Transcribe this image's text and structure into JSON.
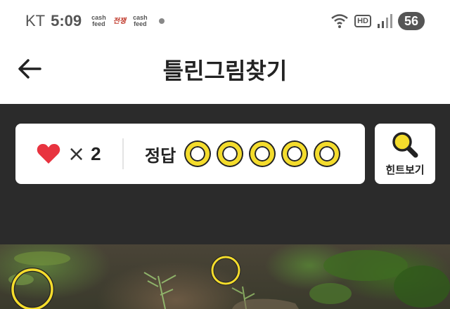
{
  "status_bar": {
    "carrier": "KT",
    "time": "5:09",
    "notifications": [
      {
        "line1": "cash",
        "line2": "feed",
        "color": "#555555"
      },
      {
        "line1": "전쟁",
        "line2": "",
        "color": "#c0392b"
      },
      {
        "line1": "cash",
        "line2": "feed",
        "color": "#555555"
      }
    ],
    "hd_label": "HD",
    "battery": "56",
    "icons": [
      "wifi-icon",
      "signal-icon"
    ]
  },
  "header": {
    "title": "틀린그림찾기",
    "back_icon": "back-arrow-icon"
  },
  "game": {
    "lives_icon": "heart-icon",
    "lives_multiplier": "×",
    "lives_count": "2",
    "answers_label": "정답",
    "answers_total": 5,
    "answers_found": 0,
    "hint_label": "힌트보기",
    "hint_icon": "magnifier-icon"
  },
  "colors": {
    "accent_yellow": "#f4dc2c",
    "heart_red": "#e8333f",
    "dark_bg": "#2b2b2b"
  }
}
